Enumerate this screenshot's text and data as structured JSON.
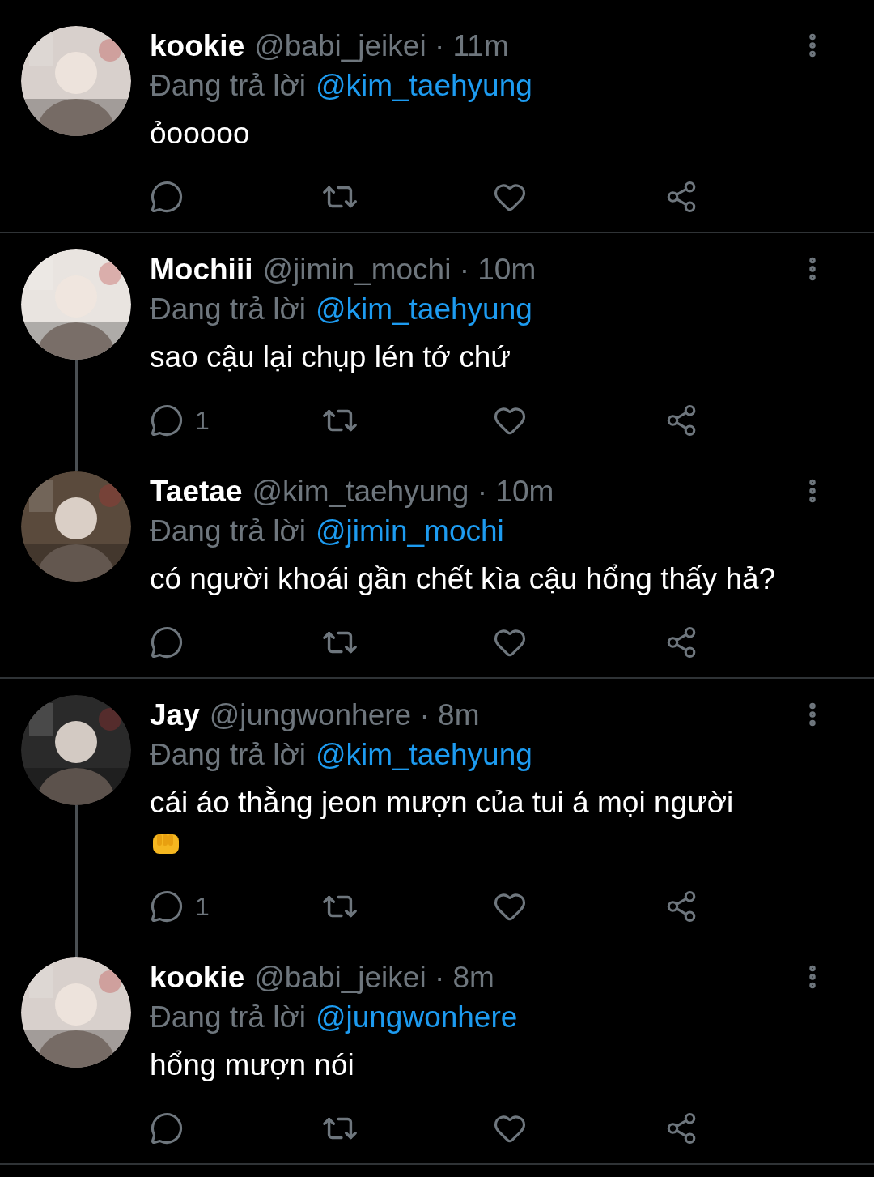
{
  "tweets": [
    {
      "name": "kookie",
      "handle": "@babi_jeikei",
      "time": "· 11m",
      "reply_prefix": "Đang trả lời",
      "reply_to": "@kim_taehyung",
      "text": "ỏooooo",
      "fist_emoji": false,
      "thread_below": false,
      "divider_below": true
    },
    {
      "name": "Mochiii",
      "handle": "@jimin_mochi",
      "time": "· 10m",
      "reply_prefix": "Đang trả lời",
      "reply_to": "@kim_taehyung",
      "text": "sao cậu lại chụp lén tớ chứ",
      "fist_emoji": false,
      "reply_count": "1",
      "thread_below": true,
      "divider_below": false
    },
    {
      "name": "Taetae",
      "handle": "@kim_taehyung",
      "time": "· 10m",
      "reply_prefix": "Đang trả lời",
      "reply_to": "@jimin_mochi",
      "text": "có người khoái gần chết kìa cậu hổng thấy hả?",
      "fist_emoji": false,
      "thread_below": false,
      "divider_below": true
    },
    {
      "name": "Jay",
      "handle": "@jungwonhere",
      "time": "· 8m",
      "reply_prefix": "Đang trả lời",
      "reply_to": "@kim_taehyung",
      "text": "cái áo thằng jeon mượn của tui á mọi người",
      "fist_emoji": true,
      "reply_count": "1",
      "thread_below": true,
      "divider_below": false
    },
    {
      "name": "kookie",
      "handle": "@babi_jeikei",
      "time": "· 8m",
      "reply_prefix": "Đang trả lời",
      "reply_to": "@jungwonhere",
      "text": "hổng mượn nói",
      "fist_emoji": false,
      "thread_below": false,
      "divider_below": true
    }
  ]
}
